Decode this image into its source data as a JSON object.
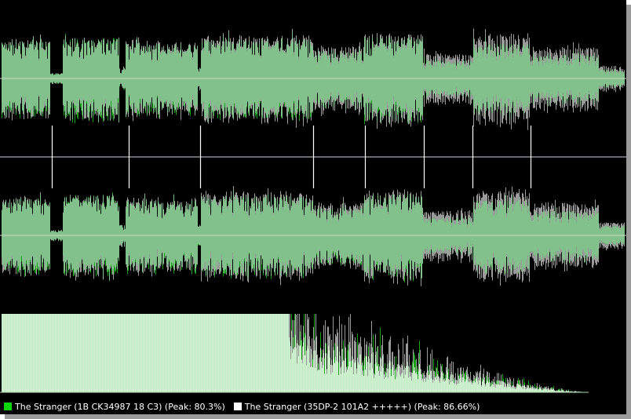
{
  "legend": [
    {
      "label": "The Stranger (1B CK34987 18 C3) (Peak: 80.3%)",
      "color": "#0bd40b"
    },
    {
      "label": "The Stranger (35DP-2 101A2 +++++) (Peak: 86.66%)",
      "color": "#ffffff"
    }
  ],
  "colors": {
    "background": "#000000",
    "overlap_fill": "#82c08c",
    "track1_only": "#16a016",
    "track2_only": "#9a9a9a",
    "centerline": "#c8dcc8",
    "divider": "#8090a0",
    "spectrum_fill": "#d4f0d4"
  },
  "chart_data": {
    "type": "area",
    "series": [
      {
        "name": "The Stranger (1B CK34987 18 C3)",
        "peak_percent": 80.3
      },
      {
        "name": "The Stranger (35DP-2 101A2 +++++)",
        "peak_percent": 86.66
      }
    ],
    "segments": [
      {
        "start": 0.0,
        "end": 0.08,
        "level1": 0.7,
        "level2": 0.72
      },
      {
        "start": 0.08,
        "end": 0.1,
        "level1": 0.1,
        "level2": 0.1
      },
      {
        "start": 0.1,
        "end": 0.19,
        "level1": 0.76,
        "level2": 0.76
      },
      {
        "start": 0.19,
        "end": 0.2,
        "level1": 0.2,
        "level2": 0.2
      },
      {
        "start": 0.2,
        "end": 0.315,
        "level1": 0.66,
        "level2": 0.7
      },
      {
        "start": 0.315,
        "end": 0.32,
        "level1": 0.2,
        "level2": 0.2
      },
      {
        "start": 0.32,
        "end": 0.5,
        "level1": 0.74,
        "level2": 0.8
      },
      {
        "start": 0.5,
        "end": 0.58,
        "level1": 0.52,
        "level2": 0.6
      },
      {
        "start": 0.58,
        "end": 0.675,
        "level1": 0.78,
        "level2": 0.84
      },
      {
        "start": 0.675,
        "end": 0.755,
        "level1": 0.34,
        "level2": 0.46
      },
      {
        "start": 0.755,
        "end": 0.845,
        "level1": 0.66,
        "level2": 0.82
      },
      {
        "start": 0.845,
        "end": 0.955,
        "level1": 0.46,
        "level2": 0.6
      },
      {
        "start": 0.955,
        "end": 1.0,
        "level1": 0.18,
        "level2": 0.24
      }
    ],
    "track_markers": [
      0.083,
      0.205,
      0.32,
      0.5,
      0.583,
      0.677,
      0.755,
      0.847
    ],
    "spectrum": {
      "bins": 200,
      "plateau_end": 0.46,
      "cutoff": 0.94
    }
  }
}
